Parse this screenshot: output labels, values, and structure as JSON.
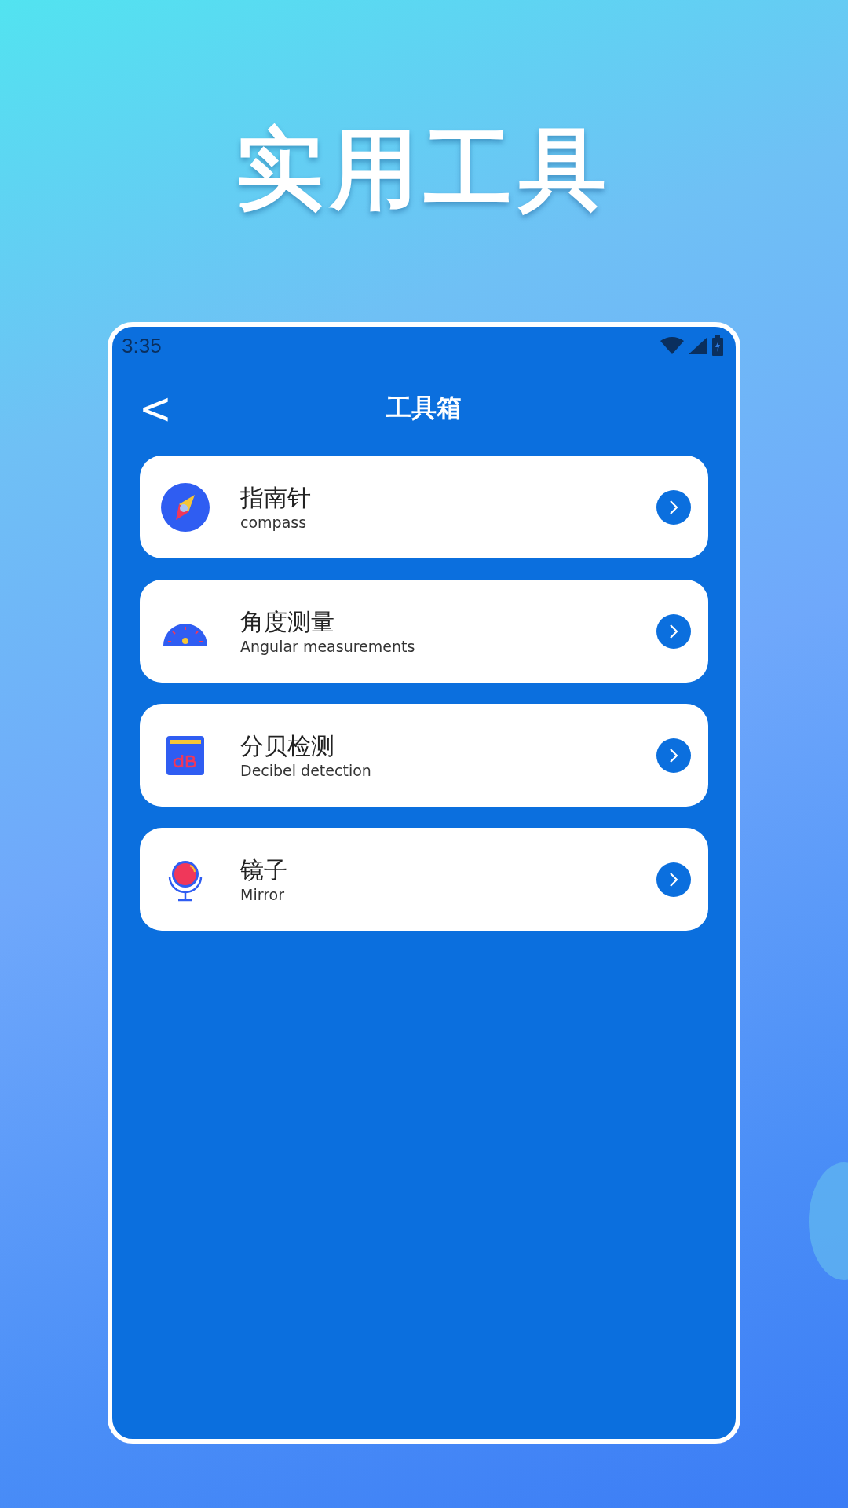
{
  "headline": "实用工具",
  "status_bar": {
    "time": "3:35"
  },
  "header": {
    "back": "<",
    "title": "工具箱"
  },
  "tools": [
    {
      "title": "指南针",
      "subtitle": "compass"
    },
    {
      "title": "角度测量",
      "subtitle": "Angular measurements"
    },
    {
      "title": "分贝检测",
      "subtitle": "Decibel detection"
    },
    {
      "title": "镜子",
      "subtitle": "Mirror"
    }
  ]
}
